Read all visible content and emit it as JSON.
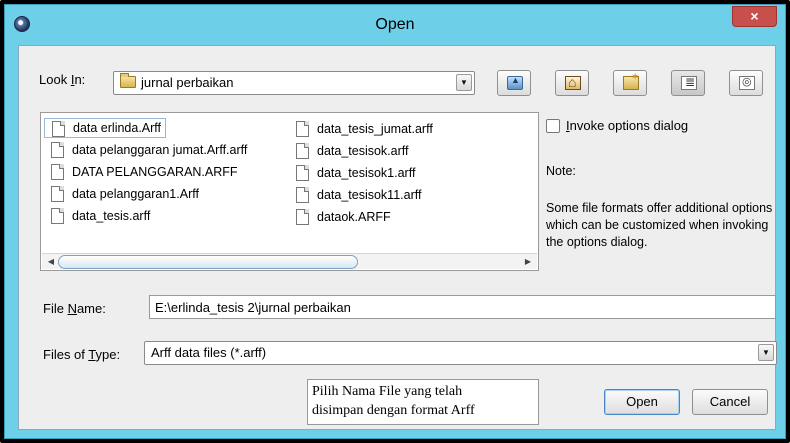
{
  "window": {
    "title": "Open",
    "close_symbol": "×"
  },
  "look_in": {
    "label_pre": "Look ",
    "label_key": "I",
    "label_post": "n:",
    "value": "jurnal perbaikan"
  },
  "toolbar": {
    "buttons": [
      {
        "name": "up-one-level",
        "icon": "folder-up-icon"
      },
      {
        "name": "home",
        "icon": "home-icon"
      },
      {
        "name": "create-new-folder",
        "icon": "new-folder-icon"
      },
      {
        "name": "list-view",
        "icon": "list-view-icon",
        "active": true
      },
      {
        "name": "details-view",
        "icon": "details-view-icon"
      }
    ]
  },
  "files": [
    {
      "name": "data erlinda.Arff",
      "selected": true
    },
    {
      "name": "data pelanggaran jumat.Arff.arff"
    },
    {
      "name": "DATA PELANGGARAN.ARFF"
    },
    {
      "name": "data pelanggaran1.Arff"
    },
    {
      "name": "data_tesis.arff"
    },
    {
      "name": "data_tesis_jumat.arff"
    },
    {
      "name": "data_tesisok.arff"
    },
    {
      "name": "data_tesisok1.arff"
    },
    {
      "name": "data_tesisok11.arff"
    },
    {
      "name": "dataok.ARFF"
    }
  ],
  "options": {
    "checkbox_key": "I",
    "checkbox_rest": "nvoke options dialog",
    "checked": false,
    "note_title": "Note:",
    "note_text": "Some file formats offer additional options which can be customized when invoking the options dialog."
  },
  "file_name": {
    "label_pre": "File ",
    "label_key": "N",
    "label_post": "ame:",
    "value": "E:\\erlinda_tesis 2\\jurnal perbaikan"
  },
  "file_type": {
    "label_pre": "Files of ",
    "label_key": "T",
    "label_post": "ype:",
    "value": "Arff data files (*.arff)"
  },
  "caption": {
    "line1": "Pilih Nama File yang telah",
    "line2": "disimpan dengan format Arff"
  },
  "buttons": {
    "open": "Open",
    "cancel": "Cancel"
  },
  "colors": {
    "frame": "#6ecfe9",
    "close": "#c7504c",
    "primary_border": "#4a86c7"
  }
}
